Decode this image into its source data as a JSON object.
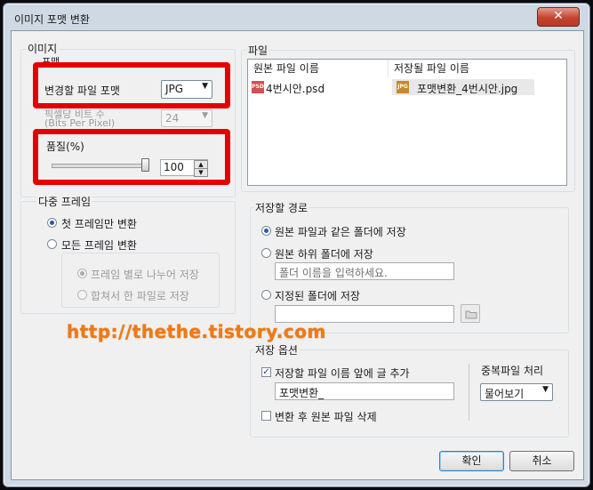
{
  "window": {
    "title": "이미지 포맷 변환",
    "close_label": "✕"
  },
  "image_group": {
    "label": "이미지",
    "format_sub_label": "포맷",
    "convert_format_label": "변경할 파일 포맷",
    "format_value": "JPG",
    "bits_label_line1": "픽셀당 비트 수",
    "bits_label_line2": "(Bits Per Pixel)",
    "bits_value": "24",
    "quality_label": "품질(%)",
    "quality_value": "100",
    "quality_level_percent": 100
  },
  "multi_frame": {
    "label": "다중 프레임",
    "first_frame_only": "첫 프레임만 변환",
    "all_frames": "모든 프레임 변환",
    "split_per_frame": "프레임 별로 나누어 저장",
    "merge_one_file": "합쳐서 한 파일로 저장"
  },
  "file_group": {
    "label": "파일",
    "columns": [
      "원본 파일 이름",
      "저장될 파일 이름"
    ],
    "rows": [
      {
        "source": "4번시안.psd",
        "source_icon": "psd-file-icon",
        "target": "포맷변환_4번시안.jpg",
        "target_icon": "jpg-file-icon"
      }
    ]
  },
  "save_path": {
    "label": "저장할 경로",
    "same_folder": "원본 파일과 같은 폴더에 저장",
    "sub_folder": "원본 하위 폴더에 저장",
    "sub_folder_placeholder": "폴더 이름을 입력하세요.",
    "specified_folder": "지정된 폴더에 저장",
    "specified_value": ""
  },
  "save_options": {
    "label": "저장 옵션",
    "prefix_check_label": "저장할 파일 이름 앞에 글 추가",
    "prefix_value": "포맷변환_",
    "duplicate_label": "중복파일 처리",
    "duplicate_value": "물어보기",
    "delete_original_label": "변환 후 원본 파일 삭제"
  },
  "buttons": {
    "ok": "확인",
    "cancel": "취소"
  },
  "watermark": "http://thethe.tistory.com",
  "colors": {
    "highlight": "#e50000",
    "watermark": "#f07a10",
    "selected_radio": "#2b59a9"
  }
}
